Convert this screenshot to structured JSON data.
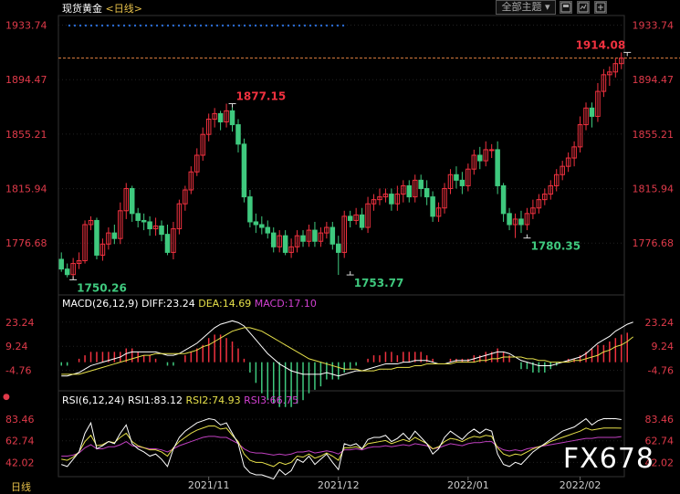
{
  "header": {
    "instrument": "现货黄金",
    "period": "<日线>",
    "theme_button": "全部主题",
    "theme_caret": "▾"
  },
  "macd_header": {
    "name": "MACD(26,12,9)",
    "diff": "DIFF:23.24",
    "dea": "DEA:14.69",
    "macd": "MACD:17.10"
  },
  "rsi_header": {
    "name": "RSI(6,12,24)",
    "rsi1": "RSI1:83.12",
    "rsi2": "RSI2:74.93",
    "rsi3": "RSI3:66.75"
  },
  "footer": {
    "period_label": "日线"
  },
  "watermark": "FX678",
  "colors": {
    "up": "#f0313f",
    "down": "#3fc97e",
    "diff": "#ffffff",
    "dea": "#e6e04a",
    "macd_label": "#d040d0",
    "rsi1": "#ffffff",
    "rsi2": "#e6e04a",
    "rsi3": "#c040c0",
    "axis_text": "#e03a4a",
    "grid": "#222222"
  },
  "chart_data": [
    {
      "type": "candlestick",
      "name": "price",
      "ylim": [
        1740,
        1940
      ],
      "y_ticks": [
        "1933.74",
        "1894.47",
        "1855.21",
        "1815.94",
        "1776.68"
      ],
      "y_tick_values": [
        1933.74,
        1894.47,
        1855.21,
        1815.94,
        1776.68
      ],
      "x_labels": [
        "2021/11",
        "2021/12",
        "2022/01",
        "2022/02"
      ],
      "x_label_index": [
        25,
        47,
        69,
        88
      ],
      "annotations": [
        {
          "label": "1914.08",
          "index": 96,
          "value": 1914.08,
          "kind": "high"
        },
        {
          "label": "1877.15",
          "index": 29,
          "value": 1877.15,
          "kind": "high"
        },
        {
          "label": "1750.26",
          "index": 2,
          "value": 1750.26,
          "kind": "low"
        },
        {
          "label": "1753.77",
          "index": 49,
          "value": 1753.77,
          "kind": "low"
        },
        {
          "label": "1780.35",
          "index": 79,
          "value": 1780.35,
          "kind": "low"
        }
      ],
      "candles": [
        [
          1765,
          1758,
          1770,
          1756
        ],
        [
          1758,
          1754,
          1762,
          1752
        ],
        [
          1754,
          1762,
          1766,
          1750.26
        ],
        [
          1762,
          1764,
          1770,
          1758
        ],
        [
          1764,
          1790,
          1793,
          1762
        ],
        [
          1790,
          1793,
          1796,
          1786
        ],
        [
          1793,
          1768,
          1795,
          1765
        ],
        [
          1768,
          1776,
          1780,
          1764
        ],
        [
          1776,
          1784,
          1788,
          1772
        ],
        [
          1784,
          1780,
          1790,
          1776
        ],
        [
          1780,
          1800,
          1806,
          1776
        ],
        [
          1800,
          1816,
          1820,
          1794
        ],
        [
          1816,
          1798,
          1818,
          1792
        ],
        [
          1798,
          1793,
          1802,
          1788
        ],
        [
          1793,
          1792,
          1798,
          1786
        ],
        [
          1792,
          1787,
          1796,
          1782
        ],
        [
          1787,
          1789,
          1795,
          1782
        ],
        [
          1789,
          1783,
          1793,
          1778
        ],
        [
          1783,
          1770,
          1790,
          1768
        ],
        [
          1770,
          1787,
          1792,
          1765
        ],
        [
          1787,
          1805,
          1808,
          1783
        ],
        [
          1805,
          1815,
          1818,
          1800
        ],
        [
          1815,
          1828,
          1832,
          1812
        ],
        [
          1828,
          1840,
          1845,
          1825
        ],
        [
          1840,
          1855,
          1860,
          1836
        ],
        [
          1855,
          1866,
          1870,
          1850
        ],
        [
          1866,
          1870,
          1874,
          1860
        ],
        [
          1870,
          1864,
          1872,
          1858
        ],
        [
          1864,
          1872,
          1877.15,
          1860
        ],
        [
          1872,
          1862,
          1875,
          1857
        ],
        [
          1862,
          1848,
          1866,
          1842
        ],
        [
          1848,
          1810,
          1852,
          1806
        ],
        [
          1810,
          1792,
          1815,
          1788
        ],
        [
          1792,
          1790,
          1798,
          1784
        ],
        [
          1790,
          1788,
          1796,
          1783
        ],
        [
          1788,
          1784,
          1793,
          1780
        ],
        [
          1784,
          1774,
          1788,
          1770
        ],
        [
          1774,
          1782,
          1786,
          1770
        ],
        [
          1782,
          1770,
          1786,
          1768
        ],
        [
          1770,
          1774,
          1780,
          1766
        ],
        [
          1774,
          1782,
          1786,
          1770
        ],
        [
          1782,
          1778,
          1786,
          1774
        ],
        [
          1778,
          1786,
          1790,
          1774
        ],
        [
          1786,
          1778,
          1792,
          1774
        ],
        [
          1778,
          1784,
          1788,
          1774
        ],
        [
          1784,
          1788,
          1792,
          1780
        ],
        [
          1788,
          1776,
          1792,
          1772
        ],
        [
          1776,
          1770,
          1782,
          1753.77
        ],
        [
          1770,
          1796,
          1800,
          1766
        ],
        [
          1796,
          1793,
          1800,
          1788
        ],
        [
          1793,
          1797,
          1802,
          1790
        ],
        [
          1797,
          1788,
          1802,
          1786
        ],
        [
          1788,
          1805,
          1810,
          1784
        ],
        [
          1805,
          1808,
          1812,
          1800
        ],
        [
          1808,
          1810,
          1816,
          1804
        ],
        [
          1810,
          1812,
          1816,
          1806
        ],
        [
          1812,
          1805,
          1816,
          1800
        ],
        [
          1805,
          1812,
          1818,
          1800
        ],
        [
          1812,
          1818,
          1822,
          1806
        ],
        [
          1818,
          1810,
          1822,
          1806
        ],
        [
          1810,
          1822,
          1826,
          1806
        ],
        [
          1822,
          1816,
          1826,
          1810
        ],
        [
          1816,
          1810,
          1822,
          1804
        ],
        [
          1810,
          1796,
          1814,
          1792
        ],
        [
          1796,
          1802,
          1806,
          1792
        ],
        [
          1802,
          1816,
          1820,
          1798
        ],
        [
          1816,
          1826,
          1830,
          1812
        ],
        [
          1826,
          1822,
          1832,
          1816
        ],
        [
          1822,
          1818,
          1828,
          1812
        ],
        [
          1818,
          1830,
          1834,
          1814
        ],
        [
          1830,
          1840,
          1844,
          1826
        ],
        [
          1840,
          1836,
          1846,
          1830
        ],
        [
          1836,
          1844,
          1850,
          1832
        ],
        [
          1844,
          1844,
          1848,
          1838
        ],
        [
          1844,
          1818,
          1850,
          1812
        ],
        [
          1818,
          1798,
          1820,
          1792
        ],
        [
          1798,
          1790,
          1802,
          1786
        ],
        [
          1790,
          1794,
          1798,
          1780.35
        ],
        [
          1794,
          1790,
          1800,
          1784
        ],
        [
          1790,
          1798,
          1802,
          1786
        ],
        [
          1798,
          1802,
          1808,
          1794
        ],
        [
          1802,
          1808,
          1812,
          1798
        ],
        [
          1808,
          1812,
          1816,
          1804
        ],
        [
          1812,
          1818,
          1822,
          1808
        ],
        [
          1818,
          1826,
          1830,
          1814
        ],
        [
          1826,
          1832,
          1836,
          1822
        ],
        [
          1832,
          1838,
          1842,
          1828
        ],
        [
          1838,
          1846,
          1850,
          1832
        ],
        [
          1846,
          1862,
          1868,
          1842
        ],
        [
          1862,
          1874,
          1878,
          1858
        ],
        [
          1874,
          1868,
          1878,
          1860
        ],
        [
          1868,
          1886,
          1892,
          1864
        ],
        [
          1886,
          1898,
          1902,
          1882
        ],
        [
          1898,
          1900,
          1904,
          1890
        ],
        [
          1900,
          1906,
          1910,
          1896
        ],
        [
          1906,
          1910,
          1914.08,
          1902
        ]
      ]
    },
    {
      "type": "macd",
      "name": "MACD(26,12,9)",
      "ylim": [
        -15,
        30
      ],
      "y_ticks": [
        "23.24",
        "9.24",
        "-4.76"
      ],
      "y_tick_values": [
        23.24,
        9.24,
        -4.76
      ],
      "diff": [
        -8,
        -8,
        -7,
        -6,
        -4,
        -2,
        -1,
        0,
        1,
        2,
        3,
        5,
        6,
        6,
        6,
        6,
        6,
        5,
        4,
        4,
        5,
        7,
        9,
        11,
        14,
        17,
        20,
        22,
        23,
        24,
        23,
        21,
        17,
        13,
        9,
        5,
        2,
        -1,
        -3,
        -5,
        -6,
        -7,
        -7,
        -7,
        -7,
        -6,
        -7,
        -8,
        -7,
        -6,
        -5,
        -5,
        -4,
        -3,
        -2,
        -1,
        -1,
        -1,
        0,
        0,
        1,
        1,
        1,
        0,
        -1,
        -1,
        0,
        1,
        1,
        1,
        2,
        3,
        4,
        5,
        6,
        6,
        5,
        3,
        1,
        0,
        -1,
        -2,
        -2,
        -2,
        -1,
        0,
        1,
        2,
        3,
        5,
        8,
        11,
        13,
        15,
        18,
        20,
        22,
        23.24
      ],
      "dea": [
        -7,
        -7,
        -7,
        -7,
        -6,
        -5,
        -4,
        -3,
        -2,
        -1,
        0,
        1,
        2,
        3,
        4,
        4,
        5,
        5,
        5,
        5,
        5,
        5,
        6,
        7,
        9,
        10,
        12,
        14,
        16,
        18,
        19,
        20,
        20,
        19,
        18,
        16,
        14,
        12,
        10,
        8,
        6,
        4,
        2,
        1,
        0,
        -1,
        -2,
        -3,
        -4,
        -4,
        -4,
        -5,
        -5,
        -5,
        -4,
        -4,
        -4,
        -3,
        -3,
        -3,
        -2,
        -2,
        -1,
        -1,
        -1,
        -1,
        -1,
        0,
        0,
        0,
        0,
        1,
        1,
        2,
        2,
        3,
        3,
        3,
        3,
        2,
        2,
        1,
        1,
        0,
        0,
        0,
        0,
        1,
        1,
        2,
        3,
        4,
        6,
        7,
        9,
        10,
        12,
        14.69
      ],
      "macd": [
        -2,
        -2,
        0,
        2,
        4,
        6,
        6,
        6,
        6,
        6,
        6,
        8,
        8,
        6,
        4,
        4,
        2,
        0,
        -2,
        -2,
        0,
        4,
        6,
        8,
        10,
        14,
        16,
        16,
        14,
        12,
        8,
        2,
        -6,
        -12,
        -18,
        -22,
        -24,
        -26,
        -26,
        -26,
        -24,
        -22,
        -18,
        -16,
        -14,
        -10,
        -10,
        -10,
        -6,
        -4,
        -2,
        0,
        2,
        4,
        4,
        6,
        6,
        4,
        6,
        6,
        6,
        6,
        4,
        2,
        0,
        0,
        2,
        2,
        2,
        2,
        4,
        4,
        6,
        6,
        8,
        6,
        4,
        0,
        -4,
        -4,
        -6,
        -6,
        -6,
        -4,
        -2,
        0,
        2,
        2,
        4,
        6,
        8,
        10,
        10,
        12,
        14,
        16,
        17.1
      ]
    },
    {
      "type": "rsi",
      "name": "RSI(6,12,24)",
      "ylim": [
        30,
        95
      ],
      "y_ticks": [
        "83.46",
        "62.74",
        "42.02"
      ],
      "y_tick_values": [
        83.46,
        62.74,
        42.02
      ],
      "rsi1": [
        40,
        38,
        45,
        52,
        70,
        80,
        55,
        58,
        62,
        60,
        70,
        78,
        60,
        55,
        52,
        48,
        50,
        45,
        38,
        55,
        66,
        72,
        76,
        80,
        82,
        84,
        83,
        78,
        80,
        70,
        60,
        38,
        32,
        30,
        30,
        28,
        26,
        35,
        30,
        34,
        45,
        42,
        48,
        40,
        45,
        50,
        42,
        35,
        60,
        58,
        60,
        55,
        64,
        66,
        66,
        68,
        62,
        65,
        70,
        64,
        72,
        66,
        60,
        50,
        55,
        66,
        72,
        68,
        64,
        70,
        74,
        70,
        74,
        72,
        50,
        40,
        38,
        42,
        40,
        46,
        52,
        56,
        60,
        64,
        68,
        72,
        74,
        76,
        80,
        84,
        78,
        82,
        84,
        84,
        84,
        83.12
      ],
      "rsi2": [
        45,
        44,
        47,
        52,
        62,
        68,
        58,
        59,
        62,
        61,
        66,
        70,
        62,
        58,
        56,
        54,
        54,
        52,
        48,
        56,
        62,
        66,
        70,
        73,
        75,
        77,
        77,
        74,
        75,
        68,
        62,
        50,
        44,
        42,
        42,
        40,
        38,
        42,
        40,
        42,
        48,
        47,
        50,
        46,
        48,
        51,
        48,
        44,
        56,
        56,
        57,
        55,
        60,
        61,
        62,
        63,
        60,
        62,
        64,
        62,
        66,
        63,
        60,
        55,
        57,
        62,
        65,
        64,
        62,
        65,
        67,
        66,
        68,
        67,
        56,
        50,
        48,
        50,
        49,
        52,
        55,
        57,
        59,
        62,
        64,
        66,
        68,
        70,
        72,
        75,
        73,
        74,
        75,
        75,
        75,
        74.93
      ],
      "rsi3": [
        48,
        48,
        49,
        51,
        56,
        59,
        55,
        55,
        57,
        57,
        59,
        62,
        58,
        57,
        56,
        55,
        55,
        54,
        52,
        55,
        58,
        60,
        62,
        64,
        66,
        67,
        67,
        66,
        66,
        63,
        60,
        55,
        52,
        51,
        51,
        50,
        49,
        50,
        49,
        50,
        52,
        52,
        53,
        51,
        52,
        53,
        52,
        50,
        54,
        54,
        55,
        54,
        56,
        57,
        57,
        58,
        57,
        58,
        59,
        58,
        60,
        59,
        58,
        55,
        56,
        58,
        60,
        59,
        58,
        60,
        61,
        61,
        62,
        62,
        57,
        54,
        53,
        54,
        53,
        55,
        56,
        57,
        58,
        59,
        60,
        61,
        62,
        63,
        64,
        65,
        65,
        66,
        66,
        66,
        66,
        66.75
      ]
    }
  ]
}
